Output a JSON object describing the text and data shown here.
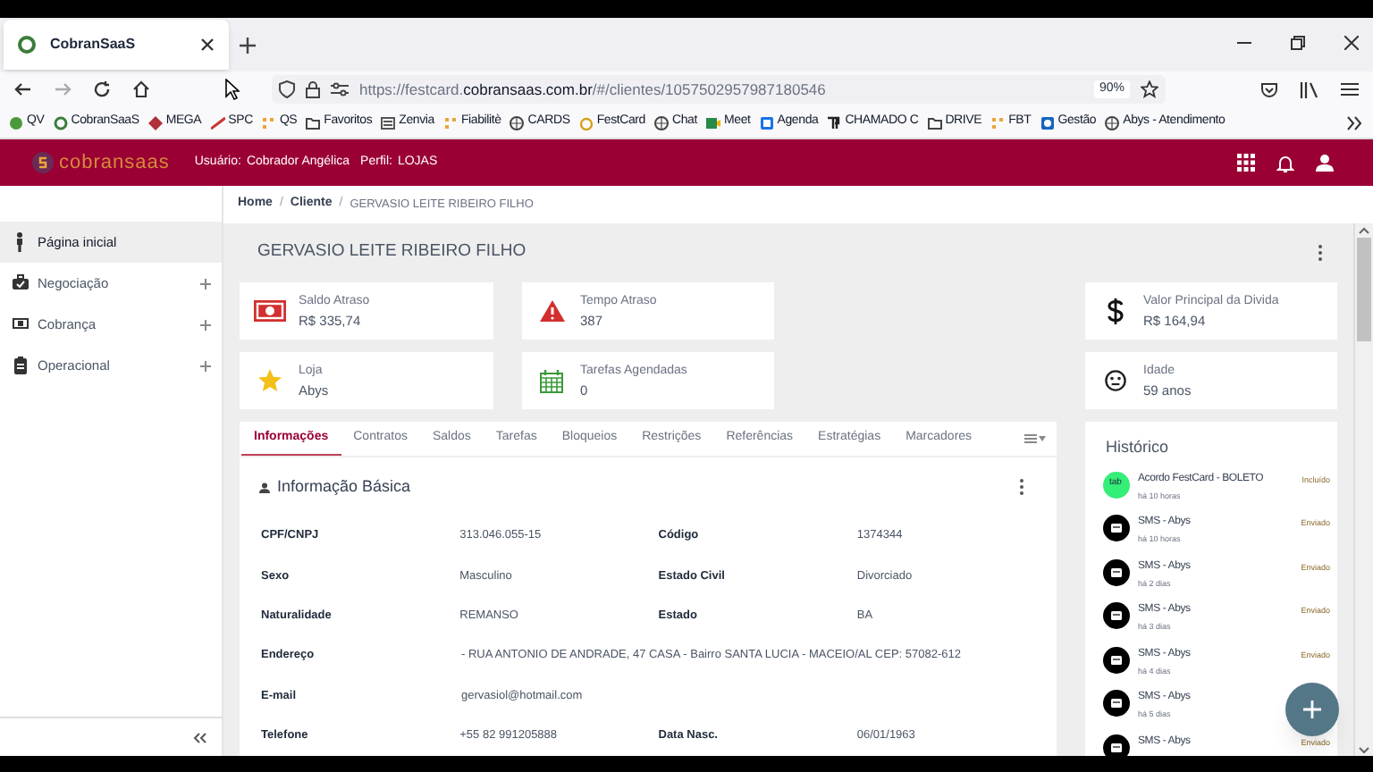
{
  "browser": {
    "tab_title": "CobranSaaS",
    "url_prefix": "https://festcard.",
    "url_domain": "cobransaas.com.br",
    "url_path": "/#/clientes/1057502957987180546",
    "zoom": "90%",
    "bookmarks": [
      {
        "label": "QV"
      },
      {
        "label": "CobranSaaS"
      },
      {
        "label": "MEGA"
      },
      {
        "label": "SPC"
      },
      {
        "label": "QS"
      },
      {
        "label": "Favoritos"
      },
      {
        "label": "Zenvia"
      },
      {
        "label": "Fiabilitè"
      },
      {
        "label": "CARDS"
      },
      {
        "label": "FestCard"
      },
      {
        "label": "Chat"
      },
      {
        "label": "Meet"
      },
      {
        "label": "Agenda"
      },
      {
        "label": "CHAMADO C"
      },
      {
        "label": "DRIVE"
      },
      {
        "label": "FBT"
      },
      {
        "label": "Gestão"
      },
      {
        "label": "Abys - Atendimento"
      }
    ]
  },
  "header": {
    "logo": "cobransaas",
    "user_label": "Usuário:",
    "user": "Cobrador Angélica",
    "profile_label": "Perfil:",
    "profile": "LOJAS"
  },
  "sidebar": {
    "items": [
      {
        "label": "Página inicial",
        "selected": true,
        "expandable": false
      },
      {
        "label": "Negociação",
        "selected": false,
        "expandable": true
      },
      {
        "label": "Cobrança",
        "selected": false,
        "expandable": true
      },
      {
        "label": "Operacional",
        "selected": false,
        "expandable": true
      }
    ]
  },
  "breadcrumb": [
    "Home",
    "Cliente",
    "GERVASIO LEITE RIBEIRO FILHO"
  ],
  "breadcrumb_separator": "/",
  "client_name": "GERVASIO LEITE RIBEIRO FILHO",
  "cards": [
    {
      "kind": "money",
      "label": "Saldo Atraso",
      "value": "R$ 335,74"
    },
    {
      "kind": "warning",
      "label": "Tempo Atraso",
      "value": "387"
    },
    {
      "kind": "dollar",
      "label": "Valor Principal da Divida",
      "value": "R$ 164,94"
    },
    {
      "kind": "star",
      "label": "Loja",
      "value": "Abys"
    },
    {
      "kind": "calendar",
      "label": "Tarefas Agendadas",
      "value": "0"
    },
    {
      "kind": "face",
      "label": "Idade",
      "value": "59 anos"
    }
  ],
  "tabs": [
    {
      "label": "Informações",
      "selected": true
    },
    {
      "label": "Contratos",
      "selected": false
    },
    {
      "label": "Saldos",
      "selected": false
    },
    {
      "label": "Tarefas",
      "selected": false
    },
    {
      "label": "Bloqueios",
      "selected": false
    },
    {
      "label": "Restrições",
      "selected": false
    },
    {
      "label": "Referências",
      "selected": false
    },
    {
      "label": "Estratégias",
      "selected": false
    },
    {
      "label": "Marcadores",
      "selected": false
    }
  ],
  "section_title": "Informação Básica",
  "fields": [
    [
      {
        "label": "CPF/CNPJ",
        "value": "313.046.055-15"
      },
      {
        "label": "Código",
        "value": "1374344"
      }
    ],
    [
      {
        "label": "Sexo",
        "value": "Masculino"
      },
      {
        "label": "Estado Civil",
        "value": "Divorciado"
      }
    ],
    [
      {
        "label": "Naturalidade",
        "value": "REMANSO"
      },
      {
        "label": "Estado",
        "value": "BA"
      }
    ],
    [
      {
        "label": "Endereço",
        "value": "- RUA ANTONIO DE ANDRADE, 47 CASA - Bairro SANTA LUCIA - MACEIO/AL CEP: 57082-612"
      }
    ],
    [
      {
        "label": "E-mail",
        "value": "gervasiol@hotmail.com"
      }
    ],
    [
      {
        "label": "Telefone",
        "value": "+55 82 991205888"
      },
      {
        "label": "Data Nasc.",
        "value": "06/01/1963"
      }
    ]
  ],
  "history": {
    "title": "Histórico",
    "items": [
      {
        "kind": "agreement",
        "badge": "tab",
        "title": "Acordo FestCard - BOLETO",
        "time": "há 10 horas",
        "status": "Incluído"
      },
      {
        "kind": "sms",
        "title": "SMS - Abys",
        "time": "há 10 horas",
        "status": "Enviado"
      },
      {
        "kind": "sms",
        "title": "SMS - Abys",
        "time": "há 2 dias",
        "status": "Enviado"
      },
      {
        "kind": "sms",
        "title": "SMS - Abys",
        "time": "há 3 dias",
        "status": "Enviado"
      },
      {
        "kind": "sms",
        "title": "SMS - Abys",
        "time": "há 4 dias",
        "status": "Enviado"
      },
      {
        "kind": "sms",
        "title": "SMS - Abys",
        "time": "há 5 dias"
      },
      {
        "kind": "sms",
        "title": "SMS - Abys",
        "status": "Enviado"
      }
    ]
  }
}
